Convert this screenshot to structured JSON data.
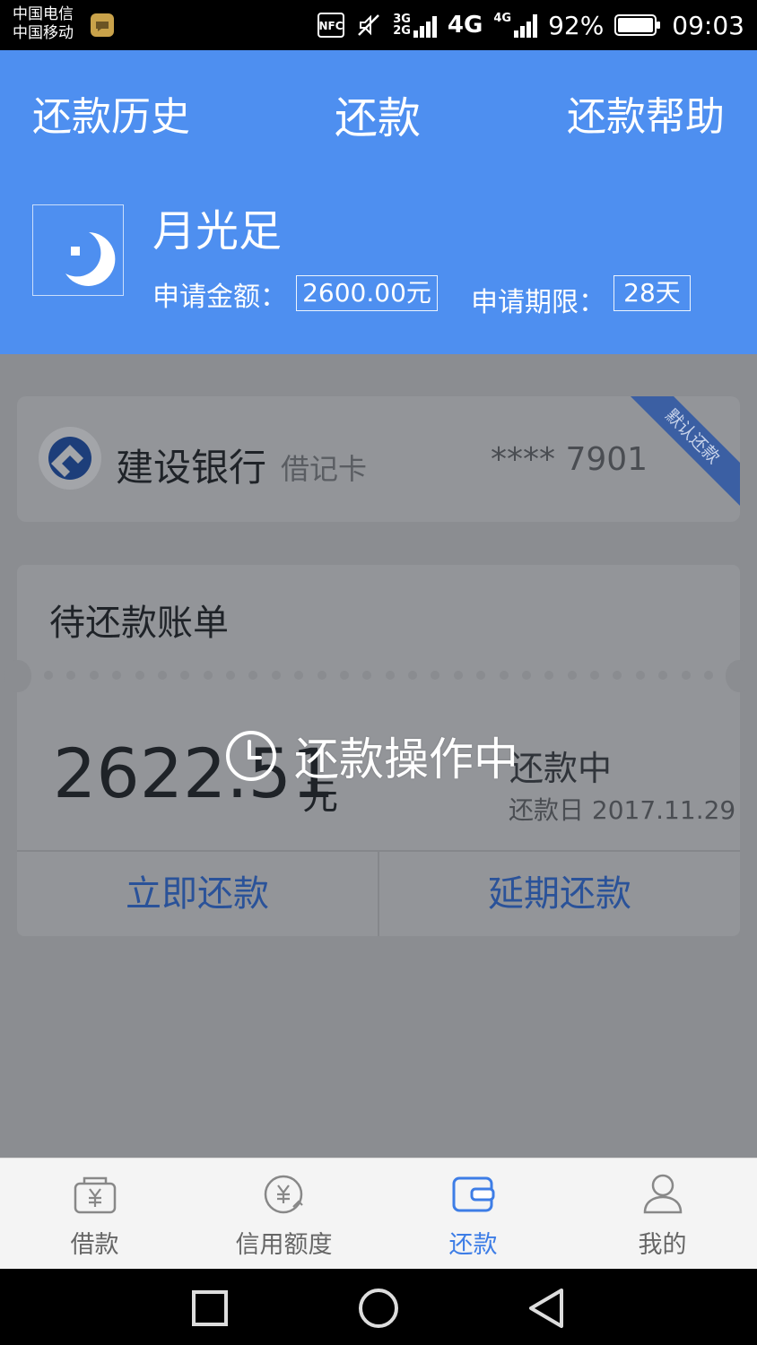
{
  "status_bar": {
    "carrier_1": "中国电信",
    "carrier_2": "中国移动",
    "net_3g": "3G",
    "net_2g": "2G",
    "net_4g_big": "4G",
    "net_4g_small": "4G",
    "battery": "92%",
    "time": "09:03"
  },
  "header": {
    "tab_history": "还款历史",
    "tab_repay": "还款",
    "tab_help": "还款帮助",
    "app_name": "月光足",
    "amount_label": "申请金额：",
    "amount_value": "2600.00元",
    "term_label": "申请期限：",
    "term_value": "28天"
  },
  "bank_card": {
    "bank_name": "建设银行",
    "card_type": "借记卡",
    "card_number": "**** 7901",
    "default_badge": "默认还款"
  },
  "bill": {
    "title": "待还款账单",
    "amount": "2622.51",
    "unit": "元",
    "status": "还款中",
    "due_date": "还款日 2017.11.29",
    "pay_now": "立即还款",
    "delay": "延期还款"
  },
  "toast": {
    "text": "还款操作中"
  },
  "tabs": [
    {
      "label": "借款",
      "icon": "borrow-yuan-icon"
    },
    {
      "label": "信用额度",
      "icon": "credit-yuan-icon"
    },
    {
      "label": "还款",
      "icon": "wallet-icon"
    },
    {
      "label": "我的",
      "icon": "user-icon"
    }
  ],
  "colors": {
    "header_blue": "#4e8ff0",
    "active_tab": "#3d7de6",
    "dim_overlay": "#8b8d91"
  }
}
